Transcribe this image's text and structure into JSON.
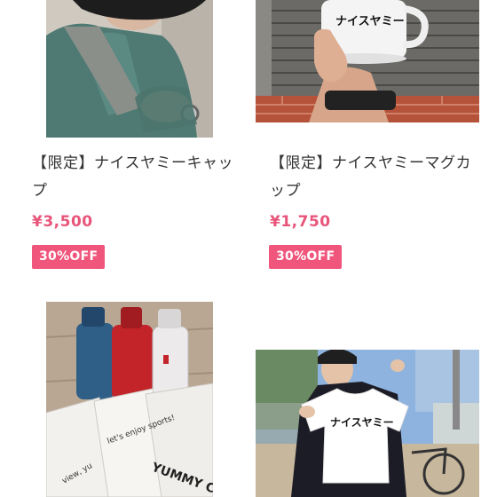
{
  "products": [
    {
      "title_line1": "【限定】ナイスヤミーキャッ",
      "title_line2": "プ",
      "price": "¥3,500",
      "discount_badge": "30%OFF",
      "image": "cap-photo"
    },
    {
      "title_line1": "【限定】ナイスヤミーマグカ",
      "title_line2": "ップ",
      "price": "¥1,750",
      "discount_badge": "30%OFF",
      "image": "mug-photo",
      "mug_print": "ナイスヤミー"
    },
    {
      "image": "bottles-towels-photo",
      "towel_print_1": "YUMMY C",
      "towel_print_2": "let's enjoy sports!",
      "towel_print_3": "view, yu"
    },
    {
      "image": "tshirt-photo",
      "shirt_print": "ナイスヤミー"
    }
  ],
  "colors": {
    "accent": "#f0557c",
    "price": "#e8557a"
  }
}
